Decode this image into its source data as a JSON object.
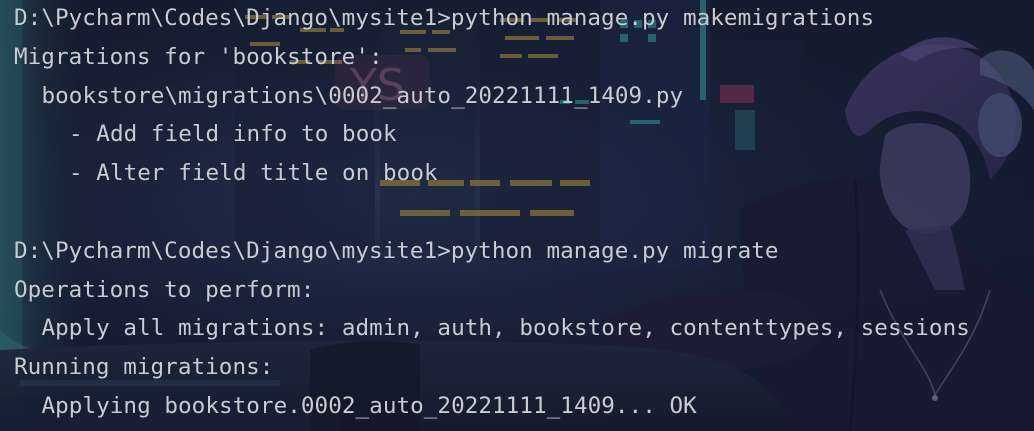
{
  "terminal": {
    "lines": [
      {
        "text": "D:\\Pycharm\\Codes\\Django\\mysite1>python manage.py makemigrations",
        "indent": 0
      },
      {
        "text": "Migrations for 'bookstore':",
        "indent": 0
      },
      {
        "text": "bookstore\\migrations\\0002_auto_20221111_1409.py",
        "indent": 1
      },
      {
        "text": "- Add field info to book",
        "indent": 2
      },
      {
        "text": "- Alter field title on book",
        "indent": 2
      },
      {
        "text": "",
        "indent": 0
      },
      {
        "text": "D:\\Pycharm\\Codes\\Django\\mysite1>python manage.py migrate",
        "indent": 0
      },
      {
        "text": "Operations to perform:",
        "indent": 0
      },
      {
        "text": "Apply all migrations: admin, auth, bookstore, contenttypes, sessions",
        "indent": 1
      },
      {
        "text": "Running migrations:",
        "indent": 0
      },
      {
        "text": "Applying bookstore.0002_auto_20221111_1409... OK",
        "indent": 1
      }
    ],
    "text_color": "#c9ccd3"
  },
  "background": {
    "colors": {
      "base": "#141b2c",
      "teal": "#2f6f72",
      "cyan": "#49c8c8",
      "violet": "#6e5b9a",
      "amber": "#e0b84a",
      "pink": "#d84b7a"
    }
  }
}
